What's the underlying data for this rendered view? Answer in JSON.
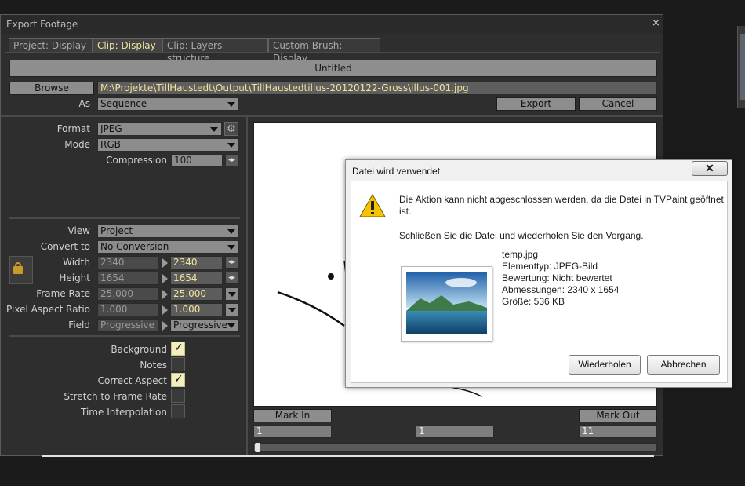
{
  "window": {
    "title": "Export Footage",
    "close_glyph": "×"
  },
  "tabs": [
    {
      "label": "Project: Display",
      "active": false
    },
    {
      "label": "Clip: Display",
      "active": true
    },
    {
      "label": "Clip: Layers structure",
      "active": false
    },
    {
      "label": "Custom Brush: Display",
      "active": false
    }
  ],
  "name_bar": "Untitled",
  "browse": {
    "label": "Browse",
    "path": "M:\\Projekte\\TillHaustedt\\Output\\TillHaustedtillus-20120122-Gross\\illus-001.jpg"
  },
  "as": {
    "label": "As",
    "value": "Sequence"
  },
  "actions": {
    "export": "Export",
    "cancel": "Cancel"
  },
  "format": {
    "label": "Format",
    "value": "JPEG"
  },
  "mode": {
    "label": "Mode",
    "value": "RGB"
  },
  "compression": {
    "label": "Compression",
    "value": "100"
  },
  "view": {
    "label": "View",
    "value": "Project"
  },
  "convert_to": {
    "label": "Convert to",
    "value": "No Conversion"
  },
  "width": {
    "label": "Width",
    "source": "2340",
    "target": "2340"
  },
  "height": {
    "label": "Height",
    "source": "1654",
    "target": "1654"
  },
  "frame_rate": {
    "label": "Frame Rate",
    "source": "25.000",
    "target": "25.000"
  },
  "pixel_aspect": {
    "label": "Pixel Aspect Ratio",
    "source": "1.000",
    "target": "1.000"
  },
  "field": {
    "label": "Field",
    "source": "Progressive",
    "target": "Progressive"
  },
  "checkboxes": [
    {
      "label": "Background",
      "checked": true
    },
    {
      "label": "Notes",
      "checked": false
    },
    {
      "label": "Correct Aspect",
      "checked": true
    },
    {
      "label": "Stretch to Frame Rate",
      "checked": false
    },
    {
      "label": "Time Interpolation",
      "checked": false
    }
  ],
  "marks": {
    "in_label": "Mark In",
    "out_label": "Mark Out",
    "in_value": "1",
    "current_value": "1",
    "out_value": "11"
  },
  "dialog": {
    "title": "Datei wird verwendet",
    "close_glyph": "✕",
    "message_line1": "Die Aktion kann nicht abgeschlossen werden, da die Datei in TVPaint geöffnet",
    "message_line2": "ist.",
    "instruction": "Schließen Sie die Datei und wiederholen Sie den Vorgang.",
    "file": {
      "name": "temp.jpg",
      "type": "Elementtyp: JPEG-Bild",
      "rating": "Bewertung: Nicht bewertet",
      "dimensions": "Abmessungen: 2340 x 1654",
      "size": "Größe: 536 KB"
    },
    "retry": "Wiederholen",
    "abort": "Abbrechen"
  },
  "colors": {
    "accent_text": "#f2e39a",
    "warning": "#f5c400"
  }
}
